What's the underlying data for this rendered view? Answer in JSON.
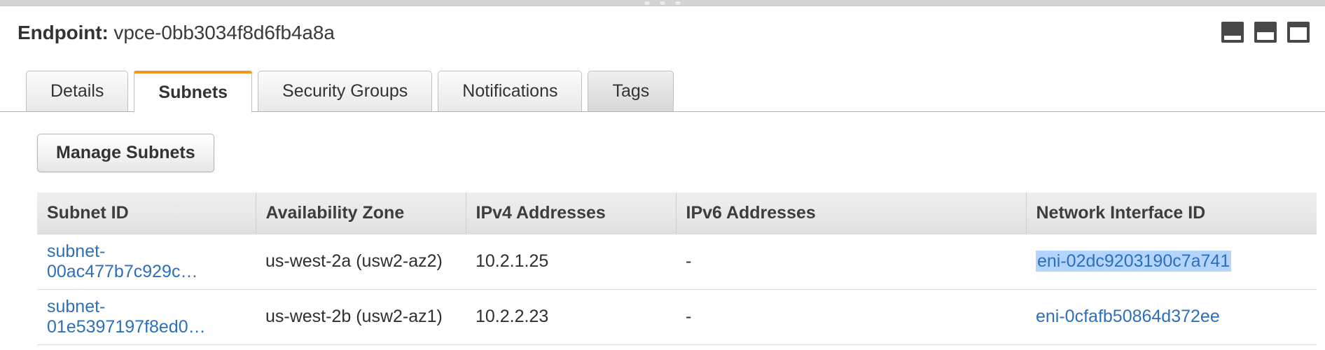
{
  "window": {
    "drag_handle_dots": 3
  },
  "header": {
    "label": "Endpoint:",
    "value": "vpce-0bb3034f8d6fb4a8a",
    "size_controls": [
      {
        "name": "panel-size-small",
        "icon": "panel-small-icon"
      },
      {
        "name": "panel-size-medium",
        "icon": "panel-medium-icon"
      },
      {
        "name": "panel-size-large",
        "icon": "panel-large-icon"
      }
    ]
  },
  "tabs": [
    {
      "label": "Details",
      "active": false,
      "hovered": false
    },
    {
      "label": "Subnets",
      "active": true,
      "hovered": false
    },
    {
      "label": "Security Groups",
      "active": false,
      "hovered": false
    },
    {
      "label": "Notifications",
      "active": false,
      "hovered": false
    },
    {
      "label": "Tags",
      "active": false,
      "hovered": true
    }
  ],
  "toolbar": {
    "manage_subnets_label": "Manage Subnets"
  },
  "table": {
    "columns": [
      "Subnet ID",
      "Availability Zone",
      "IPv4 Addresses",
      "IPv6 Addresses",
      "Network Interface ID"
    ],
    "rows": [
      {
        "subnet_id": "subnet-00ac477b7c929c…",
        "availability_zone": "us-west-2a (usw2-az2)",
        "ipv4": "10.2.1.25",
        "ipv6": "-",
        "eni": "eni-02dc9203190c7a741",
        "eni_selected": true
      },
      {
        "subnet_id": "subnet-01e5397197f8ed0…",
        "availability_zone": "us-west-2b (usw2-az1)",
        "ipv4": "10.2.2.23",
        "ipv6": "-",
        "eni": "eni-0cfafb50864d372ee",
        "eni_selected": false
      }
    ]
  },
  "colors": {
    "accent_active_tab": "#f0971d",
    "link": "#2e6fbb",
    "selection_highlight": "#b3d4fc",
    "header_text": "#333333"
  }
}
